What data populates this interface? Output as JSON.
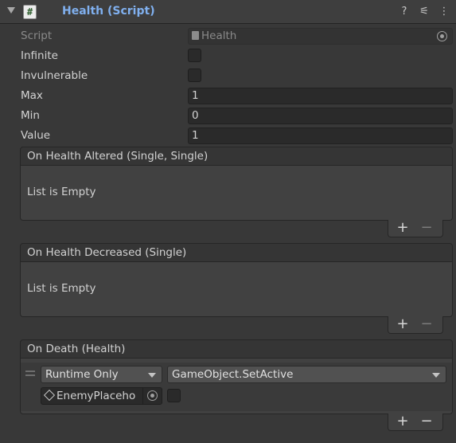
{
  "component": {
    "title": "Health (Script)",
    "script_icon_glyph": "#",
    "header_buttons": [
      {
        "name": "help-icon",
        "glyph": "?"
      },
      {
        "name": "presets-icon",
        "glyph": "⚟"
      },
      {
        "name": "kebab-menu-icon",
        "glyph": "⋮"
      }
    ]
  },
  "properties": {
    "script": {
      "label": "Script",
      "value": "Health"
    },
    "infinite": {
      "label": "Infinite",
      "checked": false
    },
    "invulnerable": {
      "label": "Invulnerable",
      "checked": false
    },
    "max": {
      "label": "Max",
      "value": "1"
    },
    "min": {
      "label": "Min",
      "value": "0"
    },
    "value": {
      "label": "Value",
      "value": "1"
    }
  },
  "events": [
    {
      "title": "On Health Altered (Single, Single)",
      "empty_text": "List is Empty"
    },
    {
      "title": "On Health Decreased (Single)",
      "empty_text": "List is Empty"
    },
    {
      "title": "On Death (Health)",
      "listener": {
        "call_state": "Runtime Only",
        "function": "GameObject.SetActive",
        "target_object": "EnemyPlaceho",
        "bool_argument": false
      }
    }
  ],
  "footer": {
    "plus": "+",
    "minus": "−"
  },
  "colors": {
    "title_blue": "#80b0ef",
    "background": "#383838",
    "field_background": "#2a2a2a"
  }
}
